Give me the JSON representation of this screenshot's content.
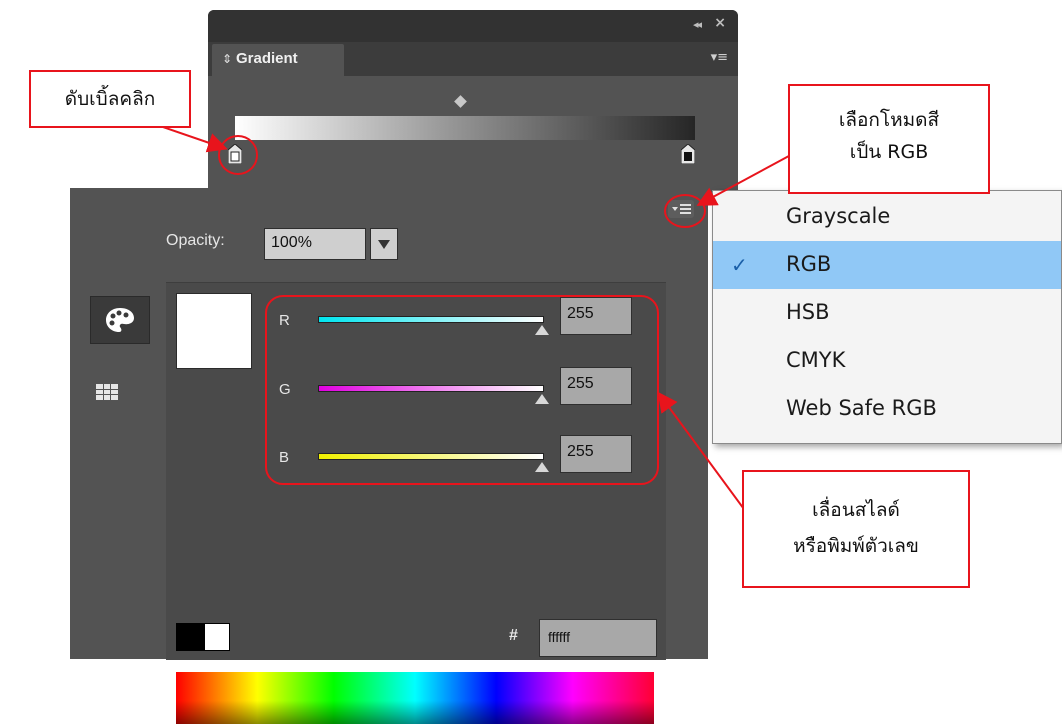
{
  "gradient_panel": {
    "title": "Gradient",
    "tab_arrows": "⇕",
    "collapse_icon": "◂◂",
    "close_icon": "×",
    "menu_icon": "▾≡"
  },
  "color_panel": {
    "opacity_label": "Opacity:",
    "opacity_value": "100%",
    "channels": [
      {
        "label": "R",
        "value": "255",
        "color": "#00e5ef"
      },
      {
        "label": "G",
        "value": "255",
        "color": "#e000e0"
      },
      {
        "label": "B",
        "value": "255",
        "color": "#f0f000"
      }
    ],
    "hex_label": "#",
    "hex_value": "ffffff",
    "preview_color": "#ffffff"
  },
  "mode_menu": {
    "items": [
      {
        "label": "Grayscale",
        "checked": false
      },
      {
        "label": "RGB",
        "checked": true
      },
      {
        "label": "HSB",
        "checked": false
      },
      {
        "label": "CMYK",
        "checked": false
      },
      {
        "label": "Web Safe RGB",
        "checked": false
      }
    ],
    "check_icon": "✓",
    "highlight_color": "#90c8f6"
  },
  "annotations": {
    "double_click": "ดับเบิ้ลคลิก",
    "choose_mode_line1": "เลือกโหมดสี",
    "choose_mode_line2": "เป็น RGB",
    "slider_line1": "เลื่อนสไลด์",
    "slider_line2": "หรือพิมพ์ตัวเลข",
    "accent_color": "#e8141c"
  }
}
